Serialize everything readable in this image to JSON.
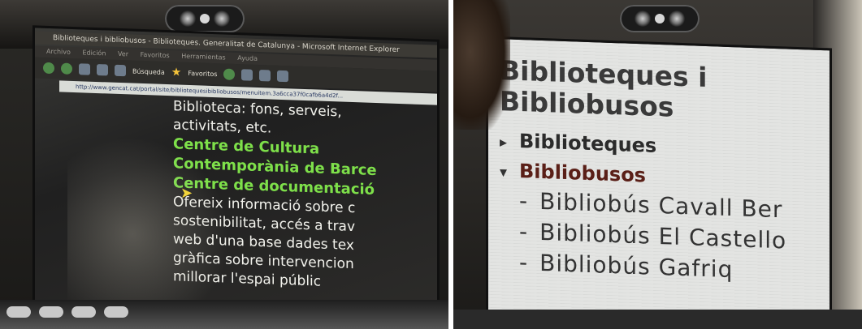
{
  "left_photo": {
    "browser": {
      "title": "Biblioteques i bibliobusos - Biblioteques. Generalitat de Catalunya - Microsoft Internet Explorer",
      "menu": [
        "Archivo",
        "Edición",
        "Ver",
        "Favoritos",
        "Herramientas",
        "Ayuda"
      ],
      "toolbar": {
        "search_label": "Búsqueda",
        "favorites_label": "Favoritos"
      },
      "address": "http://www.gencat.cat/portal/site/bibliotequesibibliobusos/menuitem.3a6cca37f0cafb6a4d2f..."
    },
    "content_lines": [
      {
        "text": "Biblioteca: fons, serveis,",
        "style": "text"
      },
      {
        "text": "activitats, etc.",
        "style": "text"
      },
      {
        "text": "Centre de Cultura",
        "style": "link"
      },
      {
        "text": "Contemporània de Barce",
        "style": "link"
      },
      {
        "text": "Centre de documentació",
        "style": "link"
      },
      {
        "text": "Ofereix informació sobre c",
        "style": "text"
      },
      {
        "text": "sostenibilitat, accés a trav",
        "style": "text"
      },
      {
        "text": "web d'una base dades tex",
        "style": "text"
      },
      {
        "text": "gràfica sobre intervencion",
        "style": "text"
      },
      {
        "text": "millorar l'espai públic",
        "style": "text"
      }
    ]
  },
  "right_photo": {
    "title_line1": "Biblioteques i",
    "title_line2": "Bibliobusos",
    "tree": [
      {
        "label": "Biblioteques",
        "arrow": "▸",
        "expanded": false
      },
      {
        "label": "Bibliobusos",
        "arrow": "▾",
        "expanded": true
      }
    ],
    "sub_items": [
      "Bibliobús Cavall Ber",
      "Bibliobús El Castello",
      "Bibliobús Gafriq"
    ],
    "dash": "-"
  },
  "colors": {
    "link_green": "#7ee04a",
    "expanded_red": "#5a1f17"
  }
}
